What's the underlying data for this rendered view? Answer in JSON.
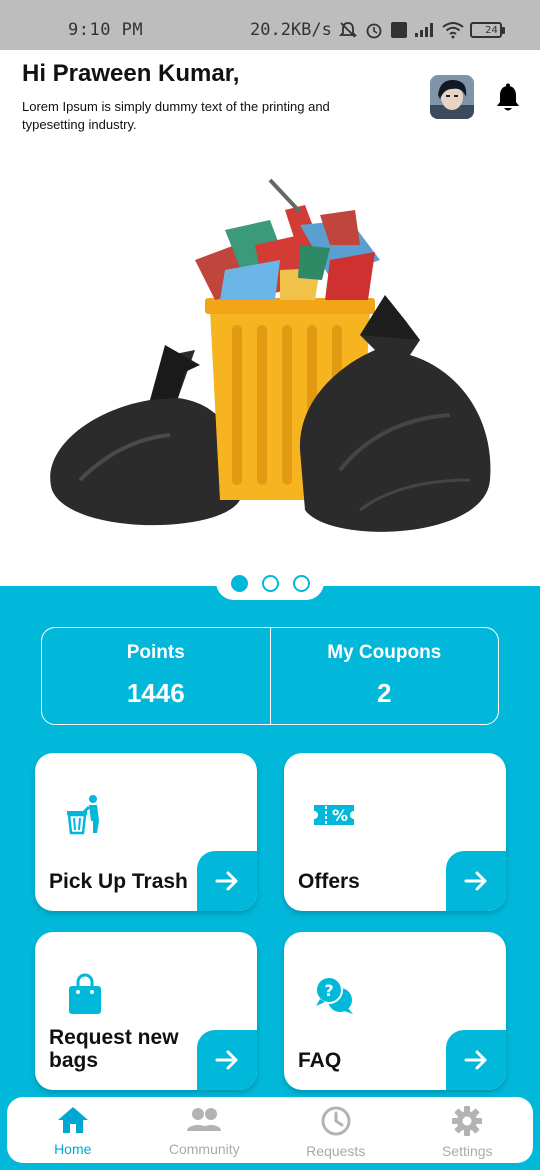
{
  "status_bar": {
    "time": "9:10 PM",
    "network_speed": "20.2KB/s",
    "volte_label": "Vo LTE",
    "battery": "24"
  },
  "header": {
    "greeting": "Hi Praween Kumar,",
    "subtitle": "Lorem Ipsum is simply dummy text of the printing and typesetting industry.",
    "avatar_icon": "avatar",
    "bell_icon": "bell-icon"
  },
  "banner": {
    "image": "trash-can-with-garbage-bags",
    "carousel": {
      "count": 3,
      "active_index": 0
    }
  },
  "stats": {
    "points_label": "Points",
    "points_value": "1446",
    "coupons_label": "My Coupons",
    "coupons_value": "2"
  },
  "cards": [
    {
      "title": "Pick Up Trash",
      "icon": "trash-bin-person-icon"
    },
    {
      "title": "Offers",
      "icon": "coupon-percent-icon"
    },
    {
      "title": "Request new bags",
      "icon": "shopping-bag-icon"
    },
    {
      "title": "FAQ",
      "icon": "faq-chat-icon"
    }
  ],
  "bottom_nav": {
    "items": [
      {
        "label": "Home",
        "icon": "home-icon",
        "active": true
      },
      {
        "label": "Community",
        "icon": "people-icon",
        "active": false
      },
      {
        "label": "Requests",
        "icon": "clock-icon",
        "active": false
      },
      {
        "label": "Settings",
        "icon": "gear-icon",
        "active": false
      }
    ]
  },
  "colors": {
    "accent": "#01b8da",
    "nav_active": "#01a7d3",
    "nav_inactive": "#aaaaaa"
  }
}
